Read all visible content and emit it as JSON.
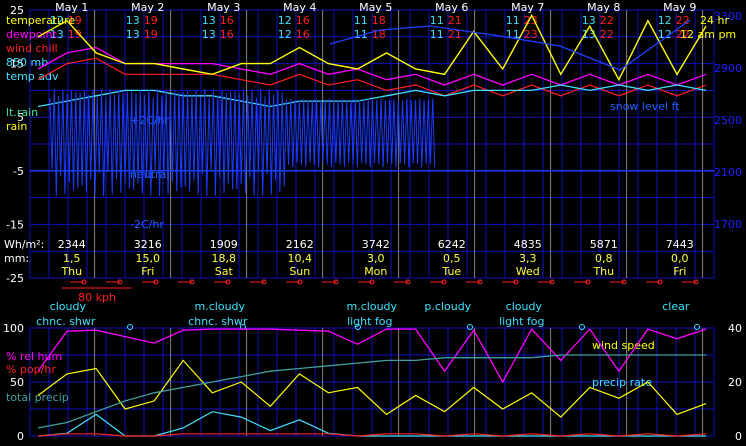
{
  "days": [
    {
      "date": "May 1",
      "weekday": "Thu",
      "temp_hi": "12",
      "temp_lo": "19",
      "dew_hi": "13",
      "dew_lo": "19",
      "wh": "2344",
      "rain_mm": "1,5",
      "sky": "cloudy",
      "wx": "chnc. shwr"
    },
    {
      "date": "May 2",
      "weekday": "Fri",
      "temp_hi": "13",
      "temp_lo": "19",
      "dew_hi": "13",
      "dew_lo": "19",
      "wh": "3216",
      "rain_mm": "15,0",
      "sky": "",
      "wx": ""
    },
    {
      "date": "May 3",
      "weekday": "Sat",
      "temp_hi": "13",
      "temp_lo": "16",
      "dew_hi": "13",
      "dew_lo": "16",
      "wh": "1909",
      "rain_mm": "18,8",
      "sky": "m.cloudy",
      "wx": "chnc. shwr"
    },
    {
      "date": "May 4",
      "weekday": "Sun",
      "temp_hi": "12",
      "temp_lo": "16",
      "dew_hi": "12",
      "dew_lo": "16",
      "wh": "2162",
      "rain_mm": "10,4",
      "sky": "",
      "wx": ""
    },
    {
      "date": "May 5",
      "weekday": "Mon",
      "temp_hi": "11",
      "temp_lo": "18",
      "dew_hi": "11",
      "dew_lo": "18",
      "wh": "3742",
      "rain_mm": "3,0",
      "sky": "m.cloudy",
      "wx": "light fog"
    },
    {
      "date": "May 6",
      "weekday": "Tue",
      "temp_hi": "11",
      "temp_lo": "21",
      "dew_hi": "11",
      "dew_lo": "21",
      "wh": "6242",
      "rain_mm": "0,5",
      "sky": "p.cloudy",
      "wx": ""
    },
    {
      "date": "May 7",
      "weekday": "Wed",
      "temp_hi": "11",
      "temp_lo": "23",
      "dew_hi": "11",
      "dew_lo": "23",
      "wh": "4835",
      "rain_mm": "3,3",
      "sky": "cloudy",
      "wx": "light fog"
    },
    {
      "date": "May 8",
      "weekday": "Thu",
      "temp_hi": "13",
      "temp_lo": "22",
      "dew_hi": "13",
      "dew_lo": "22",
      "wh": "5871",
      "rain_mm": "0,8",
      "sky": "",
      "wx": ""
    },
    {
      "date": "May 9",
      "weekday": "Fri",
      "temp_hi": "12",
      "temp_lo": "22",
      "dew_hi": "12",
      "dew_lo": "22",
      "wh": "7443",
      "rain_mm": "0,0",
      "sky": "clear",
      "wx": ""
    }
  ],
  "labels": {
    "hours": "24 hr",
    "time": "12 am pm",
    "wh_row": "Wh/m²:",
    "mm_row": "mm:",
    "wind_scale": "80 kph",
    "rate_pos": "+2C/hr",
    "rate_zero": "neutral",
    "rate_neg": "-2C/hr",
    "snow_level": "snow level ft"
  },
  "legend_top": [
    {
      "text": "temperature",
      "color": "#ffff00"
    },
    {
      "text": "dewpoint",
      "color": "#ff00ff"
    },
    {
      "text": "wind chill",
      "color": "#ff2020"
    },
    {
      "text": "850 mb",
      "color": "#40e0ff"
    },
    {
      "text": "temp adv",
      "color": "#40e0ff"
    },
    {
      "text": "lt.rain",
      "color": "#40e0a0"
    },
    {
      "text": "rain",
      "color": "#ffff00"
    }
  ],
  "legend_bottom": [
    {
      "text": "% rel hum",
      "color": "#ff00ff"
    },
    {
      "text": "% pop/hr",
      "color": "#ff2020"
    },
    {
      "text": "total precip",
      "color": "#40a0a0"
    },
    {
      "text": "wind speed",
      "color": "#ffff00"
    },
    {
      "text": "precip rate",
      "color": "#40e0ff"
    }
  ],
  "colors": {
    "grid": "#1010c0",
    "day_line": "#808080",
    "axis_left": "#ffffff",
    "axis_right": "#2020ff",
    "temp": "#ffff00",
    "dew": "#ff00ff",
    "chill": "#ff2020",
    "mb850": "#40e0ff",
    "adv": "#1a3cff",
    "snow": "#40e0ff",
    "rh": "#ff00ff",
    "pop": "#ff2020",
    "precip_total": "#40a0a0",
    "wind": "#ffff00",
    "rate": "#40e0ff"
  },
  "chart_data": [
    {
      "type": "line",
      "title": "",
      "x_categories": [
        "May 1",
        "May 2",
        "May 3",
        "May 4",
        "May 5",
        "May 6",
        "May 7",
        "May 8",
        "May 9"
      ],
      "yaxis_left": {
        "ticks": [
          "25",
          "15",
          "5",
          "-5",
          "-15",
          "-25"
        ],
        "ylim": [
          -25,
          25
        ]
      },
      "yaxis_right": {
        "ticks": [
          "3300",
          "2900",
          "2500",
          "2100",
          "1700"
        ],
        "ylim": [
          1500,
          3500
        ]
      },
      "series": [
        {
          "name": "temperature",
          "values": [
            20,
            23,
            17,
            15,
            15,
            14,
            13,
            15,
            15,
            18,
            15,
            14,
            17,
            14,
            13,
            21,
            14,
            24,
            13,
            22,
            12,
            23,
            13,
            22
          ]
        },
        {
          "name": "dewpoint",
          "values": [
            14,
            17,
            18,
            15,
            15,
            15,
            15,
            14,
            13,
            15,
            13,
            14,
            12,
            13,
            11,
            13,
            11,
            13,
            11,
            13,
            11,
            13,
            11,
            13
          ]
        },
        {
          "name": "850 mb",
          "values": [
            7,
            8,
            9,
            10,
            10,
            9,
            9,
            8,
            7,
            8,
            8,
            8,
            9,
            10,
            9,
            10,
            10,
            10,
            11,
            10,
            11,
            10,
            11,
            10
          ]
        }
      ]
    },
    {
      "type": "line",
      "yaxis_left": {
        "ticks": [
          "100",
          "50",
          "0"
        ],
        "ylim": [
          0,
          100
        ]
      },
      "yaxis_right": {
        "ticks": [
          "40",
          "20",
          "0"
        ],
        "ylim": [
          0,
          40
        ]
      },
      "series": [
        {
          "name": "% rel hum",
          "values": [
            60,
            97,
            98,
            92,
            86,
            98,
            99,
            99,
            99,
            98,
            97,
            85,
            99,
            99,
            60,
            98,
            50,
            99,
            70,
            99,
            60,
            99,
            90,
            99
          ]
        },
        {
          "name": "wind speed",
          "values": [
            15,
            23,
            25,
            10,
            13,
            28,
            16,
            20,
            11,
            23,
            16,
            18,
            8,
            15,
            9,
            18,
            10,
            16,
            7,
            18,
            14,
            20,
            8,
            12
          ]
        },
        {
          "name": "total precip",
          "values": [
            3,
            5,
            9,
            13,
            16,
            18,
            20,
            22,
            24,
            25,
            26,
            27,
            28,
            28,
            29,
            29,
            29,
            29,
            30,
            30,
            30,
            30,
            30,
            30
          ]
        },
        {
          "name": "precip rate",
          "values": [
            0,
            1,
            8,
            0,
            0,
            3,
            9,
            7,
            2,
            6,
            1,
            0,
            0,
            0,
            0,
            0,
            0,
            0,
            0,
            0,
            0,
            0,
            0,
            0
          ]
        }
      ]
    }
  ]
}
